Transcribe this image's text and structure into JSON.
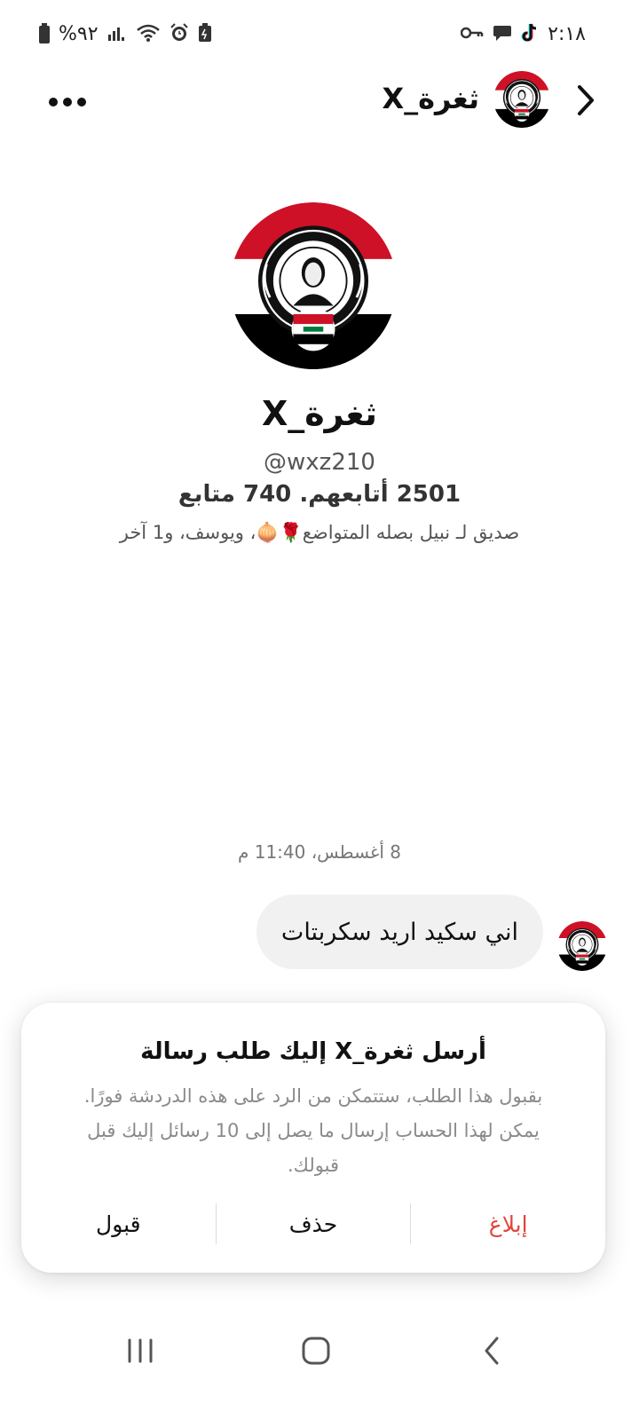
{
  "status_bar": {
    "time": "٢:١٨",
    "battery": "%٩٢"
  },
  "header": {
    "name": "ثغرة_X"
  },
  "profile": {
    "name": "ثغرة_X",
    "handle": "@wxz210",
    "stats": "2501 أتابعهم. 740 متابع",
    "mutuals": "صديق لـ نبيل بصله المتواضع🌹🧅، ويوسف، و1 آخر",
    "avatar_badge_text": "الله اكبر"
  },
  "chat": {
    "date_label": "8 أغسطس، 11:40 م",
    "message_text": "اني سكيد اريد سكربتات"
  },
  "request_card": {
    "title": "أرسل ثغرة_X إليك طلب رسالة",
    "body": "بقبول هذا الطلب، ستتمكن من الرد على هذه الدردشة فورًا. يمكن لهذا الحساب إرسال ما يصل إلى 10 رسائل إليك قبل قبولك.",
    "report_label": "إبلاغ",
    "delete_label": "حذف",
    "accept_label": "قبول"
  },
  "colors": {
    "report": "#e0453b",
    "flag_red": "#ce1126",
    "flag_black": "#000000",
    "flag_green": "#007a3d"
  },
  "icons": {
    "status_left": [
      "battery-icon",
      "signal-icon",
      "wifi-icon",
      "alarm-icon",
      "battery-saver-icon"
    ],
    "status_right": [
      "key-icon",
      "chat-bubble-icon",
      "tiktok-icon"
    ],
    "nav": [
      "recent-apps-icon",
      "home-icon",
      "back-icon"
    ]
  }
}
